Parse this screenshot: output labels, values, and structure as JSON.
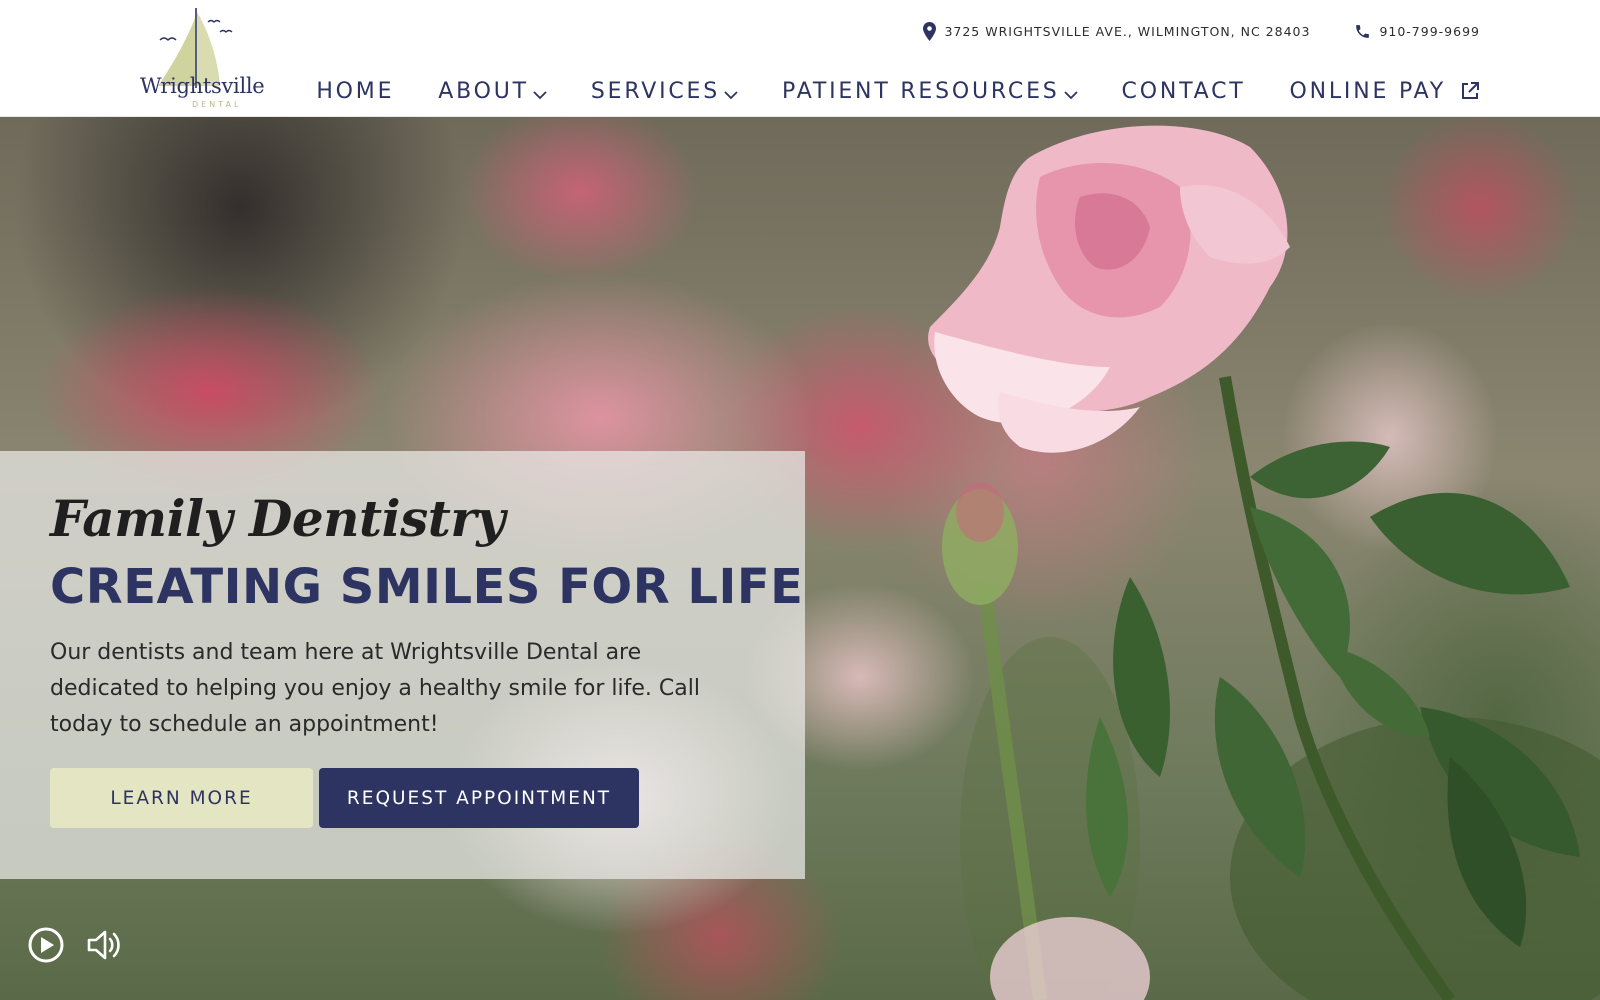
{
  "brand": {
    "logo_word": "Wrightsville",
    "logo_sub": "DENTAL",
    "colors": {
      "navy": "#2d3462",
      "cream": "#e4e6c3",
      "logo_sail": "#d9dcb0"
    }
  },
  "topbar": {
    "address_icon": "map-pin-icon",
    "address": "3725 WRIGHTSVILLE AVE., WILMINGTON, NC 28403",
    "phone_icon": "phone-icon",
    "phone": "910-799-9699"
  },
  "nav": {
    "home": "HOME",
    "about": "ABOUT",
    "services": "SERVICES",
    "patient_resources": "PATIENT RESOURCES",
    "contact": "CONTACT",
    "online_pay": "ONLINE PAY",
    "dropdown_icon": "chevron-down-icon",
    "external_icon": "external-link-icon"
  },
  "hero": {
    "script_title": "Family Dentistry",
    "title": "CREATING SMILES FOR LIFE",
    "body": "Our dentists and team here at Wrightsville Dental are dedicated to helping you enjoy a healthy smile for life. Call today to schedule an appointment!",
    "learn_more": "LEARN MORE",
    "request_appointment": "REQUEST APPOINTMENT",
    "play_icon": "play-circle-icon",
    "volume_icon": "volume-icon"
  }
}
